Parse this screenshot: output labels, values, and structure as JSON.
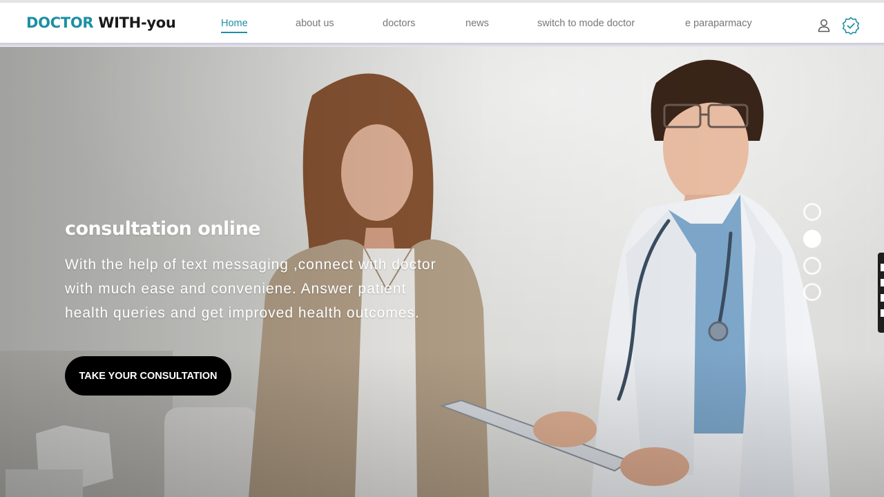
{
  "brand": {
    "part1": "DOCTOR",
    "part2": "WITH-you"
  },
  "nav": {
    "items": [
      {
        "label": "Home",
        "active": true
      },
      {
        "label": "about us"
      },
      {
        "label": "doctors"
      },
      {
        "label": "news"
      },
      {
        "label": "switch to mode doctor"
      },
      {
        "label": "e paraparmacy"
      }
    ],
    "icons": [
      "user-icon",
      "verified-badge-icon"
    ]
  },
  "hero": {
    "title": "consultation online",
    "lines": [
      "With the help of text messaging ,connect with doctor",
      "with much ease and conveniene. Answer patient",
      "health queries and get improved health outcomes."
    ],
    "cta_label": "TAKE YOUR CONSULTATION",
    "slides": {
      "count": 4,
      "active_index": 1
    }
  },
  "colors": {
    "accent": "#1d8fa3",
    "text_dark": "#1a1a1a",
    "nav_text": "#777777",
    "cta_bg": "#000000"
  }
}
